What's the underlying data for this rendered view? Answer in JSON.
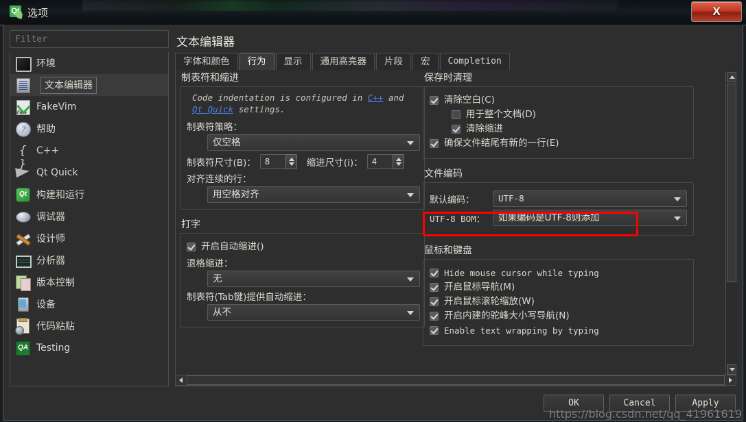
{
  "window": {
    "title": "选项",
    "app_icon": "qt-logo-icon",
    "close_label": "X"
  },
  "sidebar": {
    "filter_placeholder": "Filter",
    "items": [
      {
        "label": "环境",
        "icon": "environment-icon",
        "selected": false
      },
      {
        "label": "文本编辑器",
        "icon": "text-editor-icon",
        "selected": true
      },
      {
        "label": "FakeVim",
        "icon": "fakevim-icon",
        "selected": false
      },
      {
        "label": "帮助",
        "icon": "help-icon",
        "selected": false
      },
      {
        "label": "C++",
        "icon": "cpp-icon",
        "selected": false
      },
      {
        "label": "Qt Quick",
        "icon": "qt-quick-icon",
        "selected": false
      },
      {
        "label": "构建和运行",
        "icon": "build-run-icon",
        "selected": false
      },
      {
        "label": "调试器",
        "icon": "debugger-icon",
        "selected": false
      },
      {
        "label": "设计师",
        "icon": "designer-icon",
        "selected": false
      },
      {
        "label": "分析器",
        "icon": "analyzer-icon",
        "selected": false
      },
      {
        "label": "版本控制",
        "icon": "version-control-icon",
        "selected": false
      },
      {
        "label": "设备",
        "icon": "devices-icon",
        "selected": false
      },
      {
        "label": "代码粘贴",
        "icon": "code-paste-icon",
        "selected": false
      },
      {
        "label": "Testing",
        "icon": "testing-icon",
        "selected": false
      }
    ]
  },
  "pane": {
    "title": "文本编辑器",
    "tabs": [
      {
        "label": "字体和颜色",
        "selected": false
      },
      {
        "label": "行为",
        "selected": true
      },
      {
        "label": "显示",
        "selected": false
      },
      {
        "label": "通用高亮器",
        "selected": false
      },
      {
        "label": "片段",
        "selected": false
      },
      {
        "label": "宏",
        "selected": false
      },
      {
        "label": "Completion",
        "selected": false,
        "mono": true
      }
    ]
  },
  "tabs_indent": {
    "group_title": "制表符和缩进",
    "note_prefix": "Code indentation is configured in ",
    "note_link1": "C++",
    "note_middle": " and ",
    "note_link2": "Qt Quick",
    "note_suffix": " settings.",
    "tab_policy_label": "制表符策略：",
    "tab_policy_value": "仅空格",
    "tab_size_label": "制表符尺寸(B)：",
    "tab_size_value": "8",
    "indent_size_label": "缩进尺寸(i)：",
    "indent_size_value": "4",
    "align_label": "对齐连续的行：",
    "align_value": "用空格对齐"
  },
  "typing": {
    "group_title": "打字",
    "auto_indent_label": "开启自动缩进()",
    "auto_indent_checked": true,
    "backspace_label": "退格缩进：",
    "backspace_value": "无",
    "tab_key_label": "制表符(Tab键)提供自动缩进：",
    "tab_key_value": "从不"
  },
  "cleanup": {
    "group_title": "保存时清理",
    "items": [
      {
        "label": "清除空白(C)",
        "checked": true,
        "indent": false
      },
      {
        "label": "用于整个文档(D)",
        "checked": false,
        "indent": true
      },
      {
        "label": "清除缩进",
        "checked": true,
        "indent": true
      },
      {
        "label": "确保文件结尾有新的一行(E)",
        "checked": true,
        "indent": false
      }
    ]
  },
  "encoding": {
    "group_title": "文件编码",
    "default_label": "默认编码：",
    "default_value": "UTF-8",
    "bom_label": "UTF-8 BOM：",
    "bom_value": "如果编码是UTF-8则添加",
    "highlight_color": "#ff0000"
  },
  "mouse_keyboard": {
    "group_title": "鼠标和键盘",
    "items": [
      {
        "label": "Hide mouse cursor while typing",
        "checked": true,
        "mono": true
      },
      {
        "label": "开启鼠标导航(M)",
        "checked": true,
        "mono": false
      },
      {
        "label": "开启鼠标滚轮缩放(W)",
        "checked": true,
        "mono": false
      },
      {
        "label": "开启内建的驼峰大小写导航(N)",
        "checked": true,
        "mono": false
      },
      {
        "label": "Enable text wrapping by typing",
        "checked": true,
        "mono": true
      }
    ]
  },
  "footer": {
    "ok_label": "OK",
    "cancel_label": "Cancel",
    "apply_label": "Apply",
    "watermark": "https://blog.csdn.net/qq_41961619"
  }
}
